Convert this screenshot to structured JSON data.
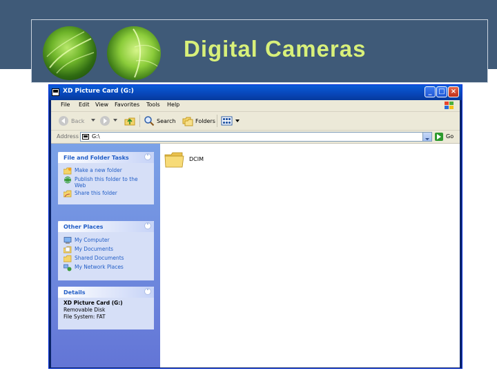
{
  "slide": {
    "title": "Digital Cameras"
  },
  "window": {
    "title": "XD Picture Card (G:)",
    "controls": {
      "minimize": "_",
      "maximize": "□",
      "close": "×"
    }
  },
  "menu": [
    "File",
    "Edit",
    "View",
    "Favorites",
    "Tools",
    "Help"
  ],
  "toolbar": {
    "back": "Back",
    "search": "Search",
    "folders": "Folders"
  },
  "address": {
    "label": "Address",
    "value": "G:\\",
    "go": "Go"
  },
  "panels": {
    "file_tasks": {
      "title": "File and Folder Tasks",
      "items": [
        "Make a new folder",
        "Publish this folder to the Web",
        "Share this folder"
      ]
    },
    "other_places": {
      "title": "Other Places",
      "items": [
        "My Computer",
        "My Documents",
        "Shared Documents",
        "My Network Places"
      ]
    },
    "details": {
      "title": "Details",
      "name": "XD Picture Card (G:)",
      "type": "Removable Disk",
      "filesystem": "File System: FAT"
    }
  },
  "files": [
    {
      "name": "DCIM",
      "icon": "folder-icon"
    }
  ],
  "colors": {
    "slide_bg": "#3f5a78",
    "title_text": "#d8f07a",
    "xp_blue": "#0a5cd8",
    "task_link": "#215dc6"
  }
}
